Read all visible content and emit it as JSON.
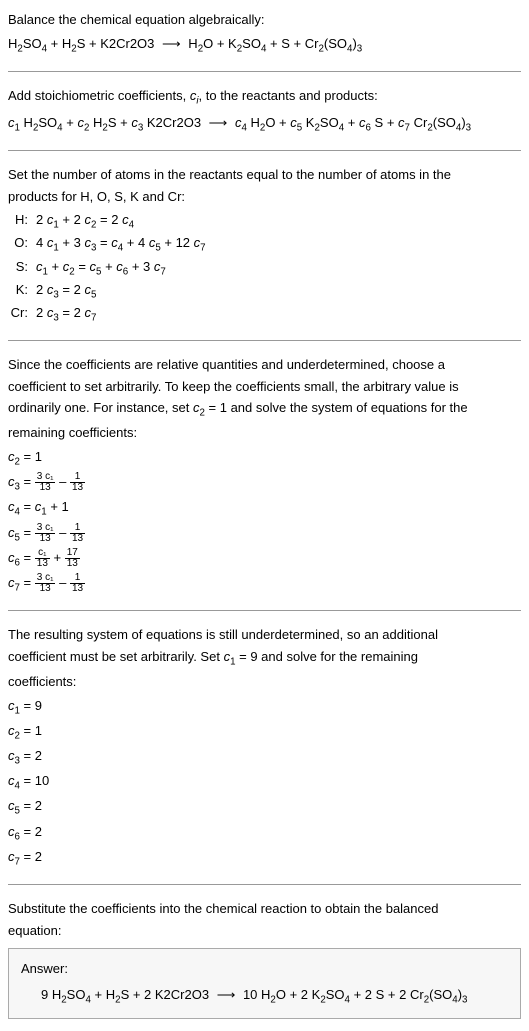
{
  "intro": {
    "line1": "Balance the chemical equation algebraically:",
    "eq_lhs": "H₂SO₄ + H₂S + K2Cr2O3",
    "eq_rhs": "H₂O + K₂SO₄ + S + Cr₂(SO₄)₃"
  },
  "step2": {
    "text": "Add stoichiometric coefficients, cᵢ, to the reactants and products:",
    "eq": "c₁ H₂SO₄ + c₂ H₂S + c₃ K2Cr2O3  ⟶  c₄ H₂O + c₅ K₂SO₄ + c₆ S + c₇ Cr₂(SO₄)₃"
  },
  "step3": {
    "text1": "Set the number of atoms in the reactants equal to the number of atoms in the",
    "text2": "products for H, O, S, K and Cr:",
    "atoms": [
      {
        "sym": "H:",
        "eq": "2 c₁ + 2 c₂ = 2 c₄"
      },
      {
        "sym": "O:",
        "eq": "4 c₁ + 3 c₃ = c₄ + 4 c₅ + 12 c₇"
      },
      {
        "sym": "S:",
        "eq": "c₁ + c₂ = c₅ + c₆ + 3 c₇"
      },
      {
        "sym": "K:",
        "eq": "2 c₃ = 2 c₅"
      },
      {
        "sym": "Cr:",
        "eq": "2 c₃ = 2 c₇"
      }
    ]
  },
  "step4": {
    "text1": "Since the coefficients are relative quantities and underdetermined, choose a",
    "text2": "coefficient to set arbitrarily. To keep the coefficients small, the arbitrary value is",
    "text3": "ordinarily one. For instance, set c₂ = 1 and solve the system of equations for the",
    "text4": "remaining coefficients:",
    "c2": "c₂ = 1",
    "c3_pre": "c₃ = ",
    "c3_n1": "3 c₁",
    "c3_d1": "13",
    "c3_mid": " – ",
    "c3_n2": "1",
    "c3_d2": "13",
    "c4": "c₄ = c₁ + 1",
    "c5_pre": "c₅ = ",
    "c5_n1": "3 c₁",
    "c5_d1": "13",
    "c5_mid": " – ",
    "c5_n2": "1",
    "c5_d2": "13",
    "c6_pre": "c₆ = ",
    "c6_n1": "c₁",
    "c6_d1": "13",
    "c6_mid": " + ",
    "c6_n2": "17",
    "c6_d2": "13",
    "c7_pre": "c₇ = ",
    "c7_n1": "3 c₁",
    "c7_d1": "13",
    "c7_mid": " – ",
    "c7_n2": "1",
    "c7_d2": "13"
  },
  "step5": {
    "text1": "The resulting system of equations is still underdetermined, so an additional",
    "text2": "coefficient must be set arbitrarily. Set c₁ = 9 and solve for the remaining",
    "text3": "coefficients:",
    "coeffs": [
      "c₁ = 9",
      "c₂ = 1",
      "c₃ = 2",
      "c₄ = 10",
      "c₅ = 2",
      "c₆ = 2",
      "c₇ = 2"
    ]
  },
  "step6": {
    "text1": "Substitute the coefficients into the chemical reaction to obtain the balanced",
    "text2": "equation:"
  },
  "answer": {
    "title": "Answer:",
    "eq": "9 H₂SO₄ + H₂S + 2 K2Cr2O3  ⟶  10 H₂O + 2 K₂SO₄ + 2 S + 2 Cr₂(SO₄)₃"
  }
}
